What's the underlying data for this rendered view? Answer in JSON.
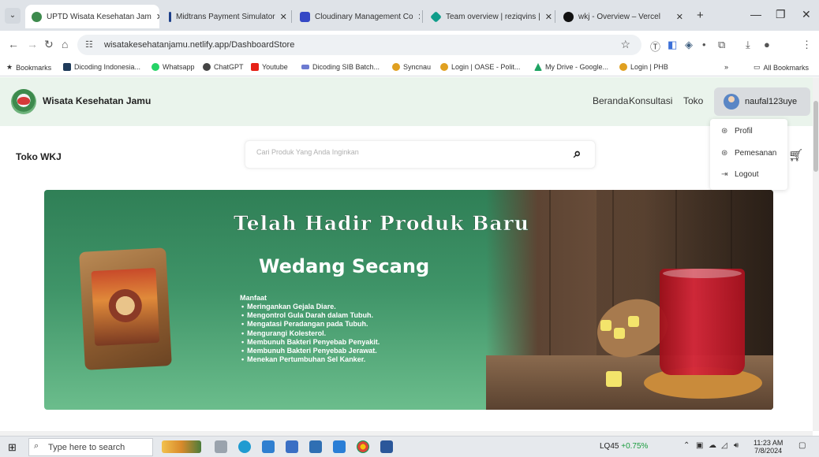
{
  "browser": {
    "tabs": [
      {
        "title": "UPTD Wisata Kesehatan Jam",
        "active": true,
        "favicon_color": "#3d8a4d"
      },
      {
        "title": "Midtrans Payment Simulator",
        "active": false,
        "favicon_color": "#1c3f8a"
      },
      {
        "title": "Cloudinary Management Co",
        "active": false,
        "favicon_color": "#3448c5"
      },
      {
        "title": "Team overview | reziqvins | ",
        "active": false,
        "favicon_color": "#0f9d8a"
      },
      {
        "title": "wkj - Overview – Vercel",
        "active": false,
        "favicon_color": "#111111"
      }
    ],
    "url": "wisatakesehatanjamu.netlify.app/DashboardStore",
    "bookmarks": [
      {
        "label": "Bookmarks",
        "color": "#555555"
      },
      {
        "label": "Dicoding Indonesia...",
        "color": "#1f3b5a"
      },
      {
        "label": "Whatsapp",
        "color": "#25d366"
      },
      {
        "label": "ChatGPT",
        "color": "#444444"
      },
      {
        "label": "Youtube",
        "color": "#e62117"
      },
      {
        "label": "Dicoding SIB Batch...",
        "color": "#6d7bd1"
      },
      {
        "label": "Syncnau",
        "color": "#e0a020"
      },
      {
        "label": "Login | OASE - Polit...",
        "color": "#e0a020"
      },
      {
        "label": "My Drive - Google...",
        "color": "#1fa463"
      },
      {
        "label": "Login | PHB",
        "color": "#e0a020"
      }
    ],
    "all_bookmarks": "All Bookmarks"
  },
  "site": {
    "brand": "Wisata Kesehatan Jamu",
    "nav": {
      "home": "Beranda",
      "consult": "Konsultasi",
      "store": "Toko"
    },
    "username": "naufal123uye",
    "store_title": "Toko WKJ",
    "search_placeholder": "Cari Produk Yang Anda Inginkan",
    "dropdown": {
      "profile": "Profil",
      "orders": "Pemesanan",
      "logout": "Logout"
    },
    "banner": {
      "headline": "Telah Hadir Produk Baru",
      "product": "Wedang Secang",
      "benefit_title": "Manfaat",
      "benefits": [
        "Meringankan Gejala Diare.",
        "Mengontrol Gula Darah dalam Tubuh.",
        "Mengatasi Peradangan pada Tubuh.",
        "Mengurangi Kolesterol.",
        "Membunuh Bakteri Penyebab Penyakit.",
        "Membunuh Bakteri Penyebab Jerawat.",
        "Menekan Pertumbuhan Sel Kanker."
      ]
    }
  },
  "taskbar": {
    "search_placeholder": "Type here to search",
    "stock_symbol": "LQ45",
    "stock_change": "+0.75%",
    "time": "11:23 AM",
    "date": "7/8/2024"
  }
}
